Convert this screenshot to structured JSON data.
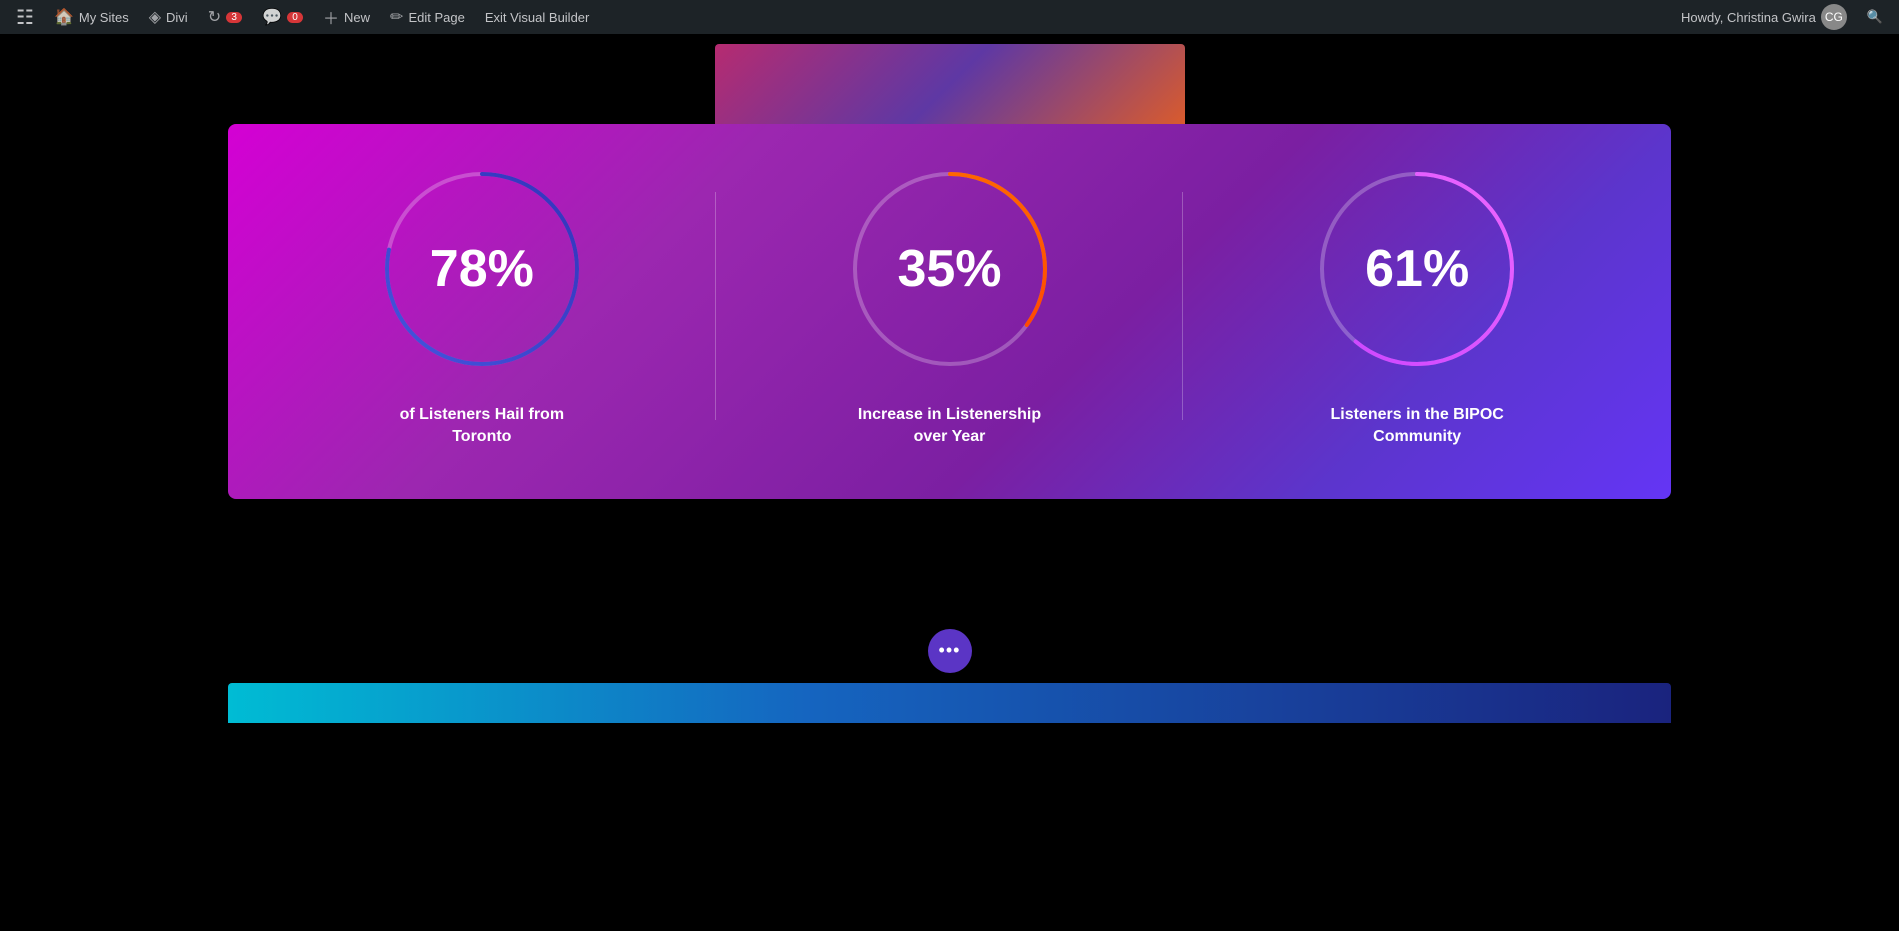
{
  "adminBar": {
    "wpLogo": "⊞",
    "mySites": "My Sites",
    "divi": "Divi",
    "updates": "3",
    "comments": "0",
    "new": "New",
    "editPage": "Edit Page",
    "exitVisualBuilder": "Exit Visual Builder",
    "howdy": "Howdy, Christina Gwira",
    "searchIcon": "🔍"
  },
  "stats": [
    {
      "value": "78%",
      "label": "of Listeners Hail from Toronto",
      "percent": 78,
      "colorStart": "#3b4fc4",
      "colorEnd": "#5c6fd4"
    },
    {
      "value": "35%",
      "label": "Increase in Listenership over Year",
      "percent": 35,
      "colorStart": "#ff6600",
      "colorEnd": "#ff3300"
    },
    {
      "value": "61%",
      "label": "Listeners in the BIPOC Community",
      "percent": 61,
      "colorStart": "#e040fb",
      "colorEnd": "#cc00ff"
    }
  ],
  "dotsButton": "•••"
}
